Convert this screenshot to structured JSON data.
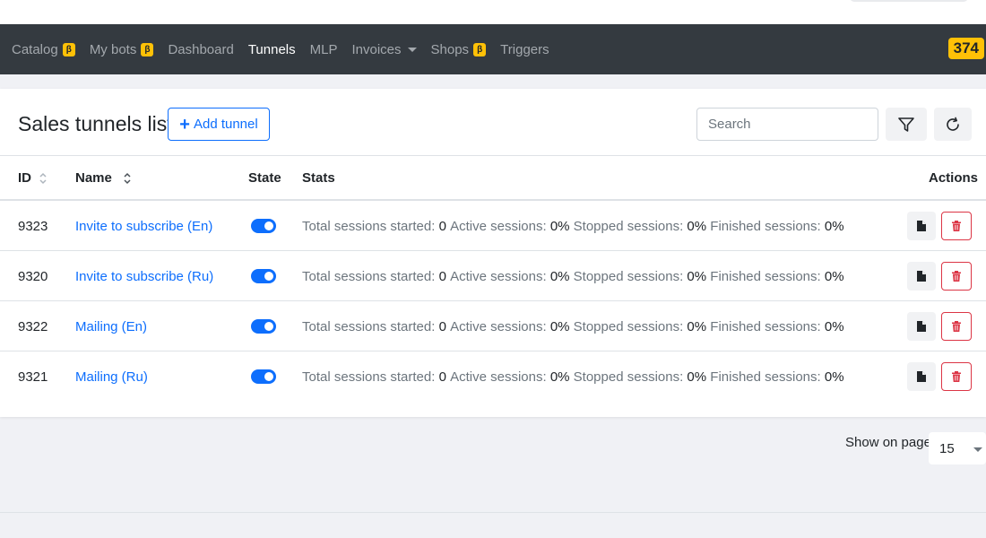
{
  "nav": {
    "items": [
      {
        "label": "Catalog",
        "badge": "β",
        "active": false
      },
      {
        "label": "My bots",
        "badge": "β",
        "active": false
      },
      {
        "label": "Dashboard",
        "badge": "",
        "active": false
      },
      {
        "label": "Tunnels",
        "badge": "",
        "active": true
      },
      {
        "label": "MLP",
        "badge": "",
        "active": false
      },
      {
        "label": "Invoices",
        "badge": "",
        "active": false,
        "dropdown": true
      },
      {
        "label": "Shops",
        "badge": "β",
        "active": false
      },
      {
        "label": "Triggers",
        "badge": "",
        "active": false
      }
    ],
    "balance": "374"
  },
  "page": {
    "title": "Sales tunnels list",
    "add_button": "Add tunnel",
    "search_placeholder": "Search"
  },
  "table": {
    "headers": {
      "id": "ID",
      "name": "Name",
      "state": "State",
      "stats": "Stats",
      "actions": "Actions"
    },
    "rows": [
      {
        "id": "9323",
        "name": "Invite to subscribe (En)",
        "enabled": true,
        "stats": [
          {
            "label": "Total sessions started:",
            "value": "0"
          },
          {
            "label": "Active sessions:",
            "value": "0%"
          },
          {
            "label": "Stopped sessions:",
            "value": "0%"
          },
          {
            "label": "Finished sessions:",
            "value": "0%"
          }
        ]
      },
      {
        "id": "9320",
        "name": "Invite to subscribe (Ru)",
        "enabled": true,
        "stats": [
          {
            "label": "Total sessions started:",
            "value": "0"
          },
          {
            "label": "Active sessions:",
            "value": "0%"
          },
          {
            "label": "Stopped sessions:",
            "value": "0%"
          },
          {
            "label": "Finished sessions:",
            "value": "0%"
          }
        ]
      },
      {
        "id": "9322",
        "name": "Mailing (En)",
        "enabled": true,
        "stats": [
          {
            "label": "Total sessions started:",
            "value": "0"
          },
          {
            "label": "Active sessions:",
            "value": "0%"
          },
          {
            "label": "Stopped sessions:",
            "value": "0%"
          },
          {
            "label": "Finished sessions:",
            "value": "0%"
          }
        ]
      },
      {
        "id": "9321",
        "name": "Mailing (Ru)",
        "enabled": true,
        "stats": [
          {
            "label": "Total sessions started:",
            "value": "0"
          },
          {
            "label": "Active sessions:",
            "value": "0%"
          },
          {
            "label": "Stopped sessions:",
            "value": "0%"
          },
          {
            "label": "Finished sessions:",
            "value": "0%"
          }
        ]
      }
    ]
  },
  "pagination": {
    "label": "Show on page",
    "page_size": "15"
  },
  "colors": {
    "accent": "#0d6efd",
    "navbar": "#343a40",
    "badge": "#ffc107",
    "danger": "#dc3545"
  },
  "icons": {
    "add": "plus-icon",
    "filter": "filter-icon",
    "refresh": "refresh-icon",
    "sort": "sort-icon",
    "doc": "document-icon",
    "delete": "trash-icon"
  }
}
